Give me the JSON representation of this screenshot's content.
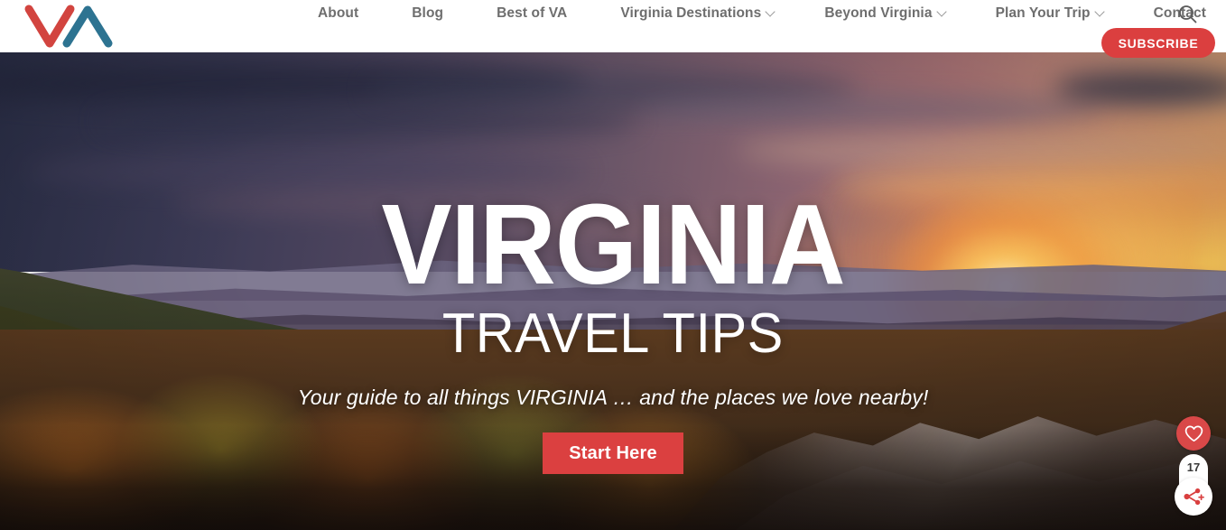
{
  "header": {
    "logo": {
      "name": "virginia-travel-tips-logo",
      "letters": "VA",
      "v_color": "#d2443f",
      "a_color": "#2d7391"
    },
    "nav": [
      {
        "label": "About",
        "has_dropdown": false
      },
      {
        "label": "Blog",
        "has_dropdown": false
      },
      {
        "label": "Best of VA",
        "has_dropdown": false
      },
      {
        "label": "Virginia Destinations",
        "has_dropdown": true
      },
      {
        "label": "Beyond Virginia",
        "has_dropdown": true
      },
      {
        "label": "Plan Your Trip",
        "has_dropdown": true
      },
      {
        "label": "Contact",
        "has_dropdown": false
      }
    ],
    "search_icon": "search-icon",
    "subscribe_label": "SUBSCRIBE",
    "subscribe_color": "#db3f3f",
    "nav_text_color": "#6e6e6e",
    "background": "#ffffff"
  },
  "hero": {
    "title": "VIRGINIA",
    "subtitle": "TRAVEL TIPS",
    "tagline": "Your guide to all things VIRGINIA … and the places we love nearby!",
    "cta_label": "Start Here",
    "cta_color": "#db4040",
    "text_color": "#ffffff",
    "image_description": "Sunset over forested Blue Ridge mountains with autumn foliage and rocky outcrop"
  },
  "widgets": {
    "favorite": {
      "icon": "heart-icon",
      "color": "#d94848"
    },
    "share": {
      "icon": "share-icon",
      "count": "17",
      "icon_color": "#d93f3f",
      "background": "#ffffff"
    }
  }
}
